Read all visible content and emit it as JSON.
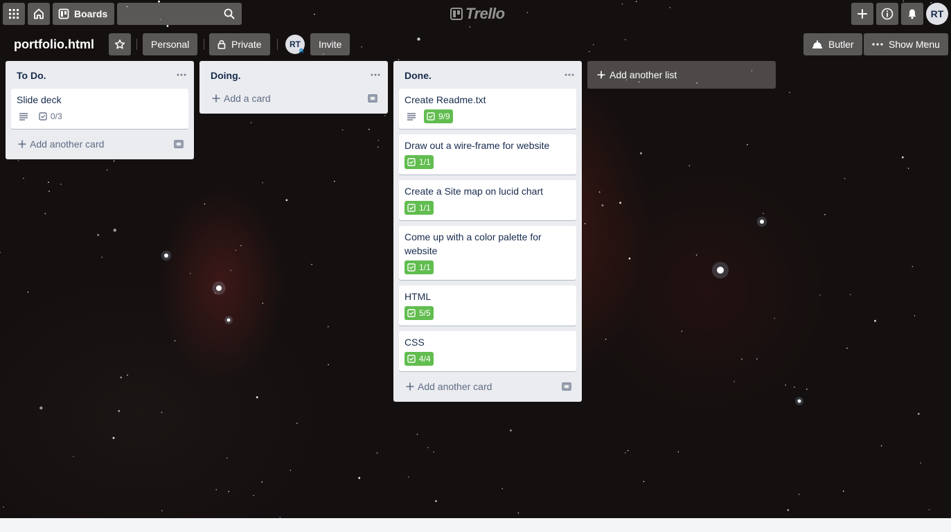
{
  "nav": {
    "apps_icon": "grid-icon",
    "home_icon": "home-icon",
    "boards_label": "Boards",
    "search_value": "",
    "search_placeholder": "",
    "logo_text": "Trello",
    "user_initials": "RT"
  },
  "board": {
    "title": "portfolio.html",
    "team_label": "Personal",
    "visibility_label": "Private",
    "member_initials": "RT",
    "invite_label": "Invite",
    "butler_label": "Butler",
    "show_menu_label": "Show Menu"
  },
  "lists": [
    {
      "title": "To Do.",
      "cards": [
        {
          "title": "Slide deck",
          "has_description": true,
          "checklist": "0/3",
          "complete": false
        }
      ],
      "add_label": "Add another card"
    },
    {
      "title": "Doing.",
      "cards": [],
      "add_label": "Add a card"
    },
    {
      "title": "Done.",
      "cards": [
        {
          "title": "Create Readme.txt",
          "has_description": true,
          "checklist": "9/9",
          "complete": true
        },
        {
          "title": "Draw out a wire-frame for website",
          "has_description": false,
          "checklist": "1/1",
          "complete": true
        },
        {
          "title": "Create a Site map on lucid chart",
          "has_description": false,
          "checklist": "1/1",
          "complete": true
        },
        {
          "title": "Come up with a color palette for website",
          "has_description": false,
          "checklist": "1/1",
          "complete": true
        },
        {
          "title": "HTML",
          "has_description": false,
          "checklist": "5/5",
          "complete": true
        },
        {
          "title": "CSS",
          "has_description": false,
          "checklist": "4/4",
          "complete": true
        }
      ],
      "add_label": "Add another card"
    }
  ],
  "add_list_label": "Add another list",
  "colors": {
    "complete_badge": "#61bd4f",
    "list_bg": "#ebecf0",
    "text": "#172b4d"
  }
}
